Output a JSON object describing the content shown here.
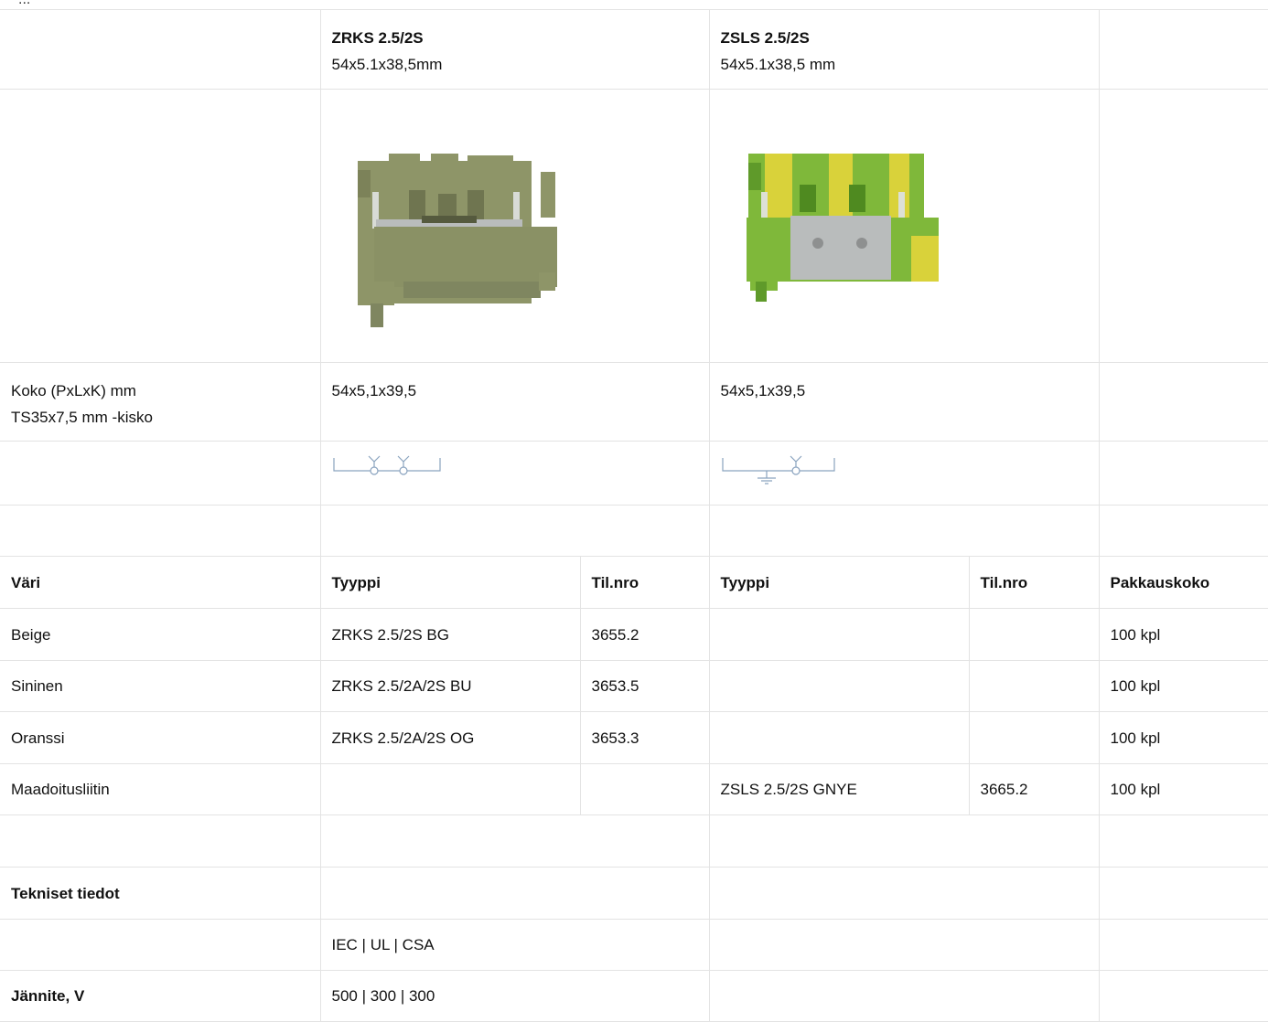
{
  "top_fragment": "...",
  "products": [
    {
      "name": "ZRKS 2.5/2S",
      "dims": "54x5.1x38,5mm",
      "size": "54x5,1x39,5"
    },
    {
      "name": "ZSLS 2.5/2S",
      "dims": "54x5.1x38,5 mm",
      "size": "54x5,1x39,5"
    }
  ],
  "size_label_1": "Koko (PxLxK) mm",
  "size_label_2": "TS35x7,5 mm -kisko",
  "order_header": {
    "color": "Väri",
    "type1": "Tyyppi",
    "no1": "Til.nro",
    "type2": "Tyyppi",
    "no2": "Til.nro",
    "pack": "Pakkauskoko"
  },
  "order_rows": [
    {
      "color": "Beige",
      "type1": "ZRKS 2.5/2S BG",
      "no1": "3655.2",
      "type2": "",
      "no2": "",
      "pack": "100 kpl"
    },
    {
      "color": "Sininen",
      "type1": "ZRKS 2.5/2A/2S BU",
      "no1": "3653.5",
      "type2": "",
      "no2": "",
      "pack": "100 kpl"
    },
    {
      "color": "Oranssi",
      "type1": "ZRKS 2.5/2A/2S OG",
      "no1": "3653.3",
      "type2": "",
      "no2": "",
      "pack": "100 kpl"
    },
    {
      "color": "Maadoitusliitin",
      "type1": "",
      "no1": "",
      "type2": "ZSLS 2.5/2S GNYE",
      "no2": "3665.2",
      "pack": "100 kpl"
    }
  ],
  "tech": {
    "title": "Tekniset tiedot",
    "standards": "IEC | UL | CSA",
    "voltage_label": "Jännite, V",
    "voltage_value": "500 | 300 | 300"
  },
  "colors": {
    "beige_body": "#8e9568",
    "green": "#7fb83a",
    "yellow": "#d9d23a",
    "metal": "#b9bcbc"
  }
}
